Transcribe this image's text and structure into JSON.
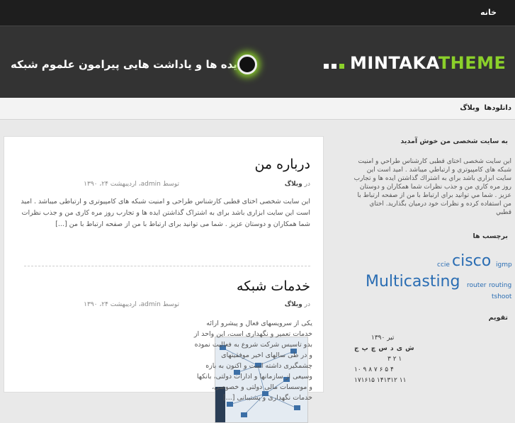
{
  "topbar": {
    "home_label": "خانه"
  },
  "header": {
    "logo_main": "MINTAKA",
    "logo_accent": "THEME",
    "tagline": "ایده ها و یاداشت هایی پیرامون علموم شبکه"
  },
  "nav": {
    "items": [
      "دانلودها",
      "وبلاگ"
    ]
  },
  "posts": [
    {
      "title": "درباره من",
      "category_prefix": "در",
      "category": "وبلاگ",
      "meta": "توسط admin، اردیبهشت ۲۴، ۱۳۹۰",
      "excerpt": "این سایت شخصی اختای قطبی کارشناس طراحی و امنیت شبکه های کامپیوتری و ارتباطی میباشد . امید است این سایت ابزاری باشد برای به اشتراک گذاشتن ایده ها و تجارب روز مره کاری من و جذب نظرات شما همکاران و دوستان عزیز . شما می توانید برای ارتباط با من از صفحه ارتباط با من [...]"
    },
    {
      "title": "خدمات شبکه",
      "category_prefix": "در",
      "category": "وبلاگ",
      "meta": "توسط admin، اردیبهشت ۲۴، ۱۳۹۰",
      "excerpt": "یکی از سرویسهای فعال و پیشرو ارائه خدمات تعمیر و نگهداری است، این واحد از بدو تاسیس شرکت شروع به فعالیت نموده و در طی سالهای اخیر موفقیتهای چشمگیری داشته است و اکنون به بازه وسیعی از سازمانها و ادارات دولتی، بانکها و موسسات مالی دولتی و خصوصی، خدمات نگهداری و پشتیبانی [...]"
    }
  ],
  "sidebar": {
    "welcome_title": "به سایت شخصی من خوش آمدید",
    "welcome_text": "این سایت شخصی اختای قطبی کارشناس طراحي و امنیت شبکه های کامپیوتري و ارتباطي ميباشد . اميد است این سایت ابزاري باشد براي به اشتراك گذاشتن ایده ها و تجارب روز مره كاري من و جذب نظرات شما همكاران و دوستان عزيز . شما مي توانيد براي ارتباط با من از صفحه ارتباط با من استفاده كرده و نظرات خود درمیان بگذارید. اختاي قطبي",
    "tags_title": "برچسب ها",
    "tags": [
      "ccie",
      "cisco",
      "igmp",
      "Multicasting",
      "router",
      "routing",
      "tshoot"
    ],
    "calendar_title": "تقویم",
    "calendar_month": "تیر ۱۳۹۰",
    "calendar_days": "ش ی د س چ پ ج",
    "calendar_rows": [
      "۳  ۲  ۱",
      "۱۰  ۹  ۸  ۷  ۶  ۵  ۴",
      "۱۷۱۶۱۵ ۱۴۱۳۱۲ ۱۱"
    ]
  },
  "colors": {
    "accent": "#8bd02a",
    "link": "#2a6db3",
    "topbar": "#1e1e1e",
    "header": "#333333"
  }
}
